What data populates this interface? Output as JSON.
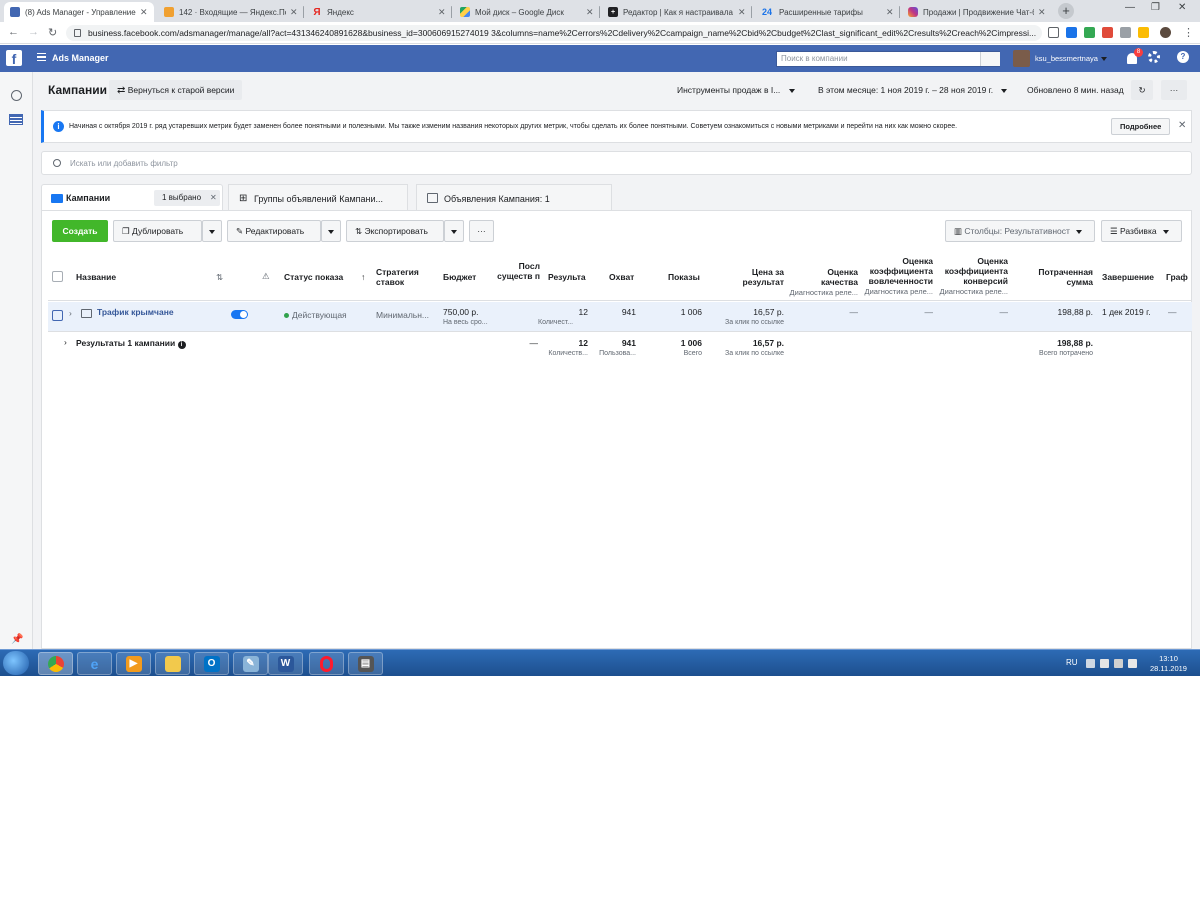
{
  "browser": {
    "tabs": [
      {
        "title": "(8) Ads Manager - Управление р",
        "icon_color": "#4267b2",
        "icon": "document-icon",
        "active": true
      },
      {
        "title": "142 · Входящие — Яндекс.Почта",
        "icon_color": "#f0a030",
        "icon": "mail-icon",
        "active": false
      },
      {
        "title": "Яндекс",
        "icon_color": "#e52620",
        "icon": "yandex-icon",
        "active": false
      },
      {
        "title": "Мой диск – Google Диск",
        "icon_color": "#1fa463",
        "icon": "drive-icon",
        "active": false
      },
      {
        "title": "Редактор | Как я настраивала та",
        "icon_color": "#202124",
        "icon": "plus-icon",
        "active": false
      },
      {
        "title": "Расширенные тарифы",
        "icon_color": "#1a73e8",
        "icon": "24-icon",
        "active": false
      },
      {
        "title": "Продажи | Продвижение Чат-б",
        "icon_color": "#c13584",
        "icon": "instagram-icon",
        "active": false
      }
    ],
    "url": "business.facebook.com/adsmanager/manage/all?act=431346240891628&business_id=300606915274019 3&columns=name%2Cerrors%2Cdelivery%2Ccampaign_name%2Cbid%2Cbudget%2Clast_significant_edit%2Cresults%2Creach%2Cimpressi..."
  },
  "fbbar": {
    "title": "Ads Manager",
    "search_placeholder": "Поиск в компании",
    "username": "ksu_bessmertnaya",
    "notif_count": "8"
  },
  "header": {
    "title": "Кампании",
    "old_version": "Вернуться к старой версии",
    "sales_tools": "Инструменты продаж в I...",
    "date_range": "В этом месяце: 1 ноя 2019 г. – 28 ноя 2019 г.",
    "updated": "Обновлено 8 мин. назад"
  },
  "banner": {
    "text": "Начиная с октября 2019 г. ряд устаревших метрик будет заменен более понятными и полезными. Мы также изменим названия некоторых других метрик, чтобы сделать их более понятными. Советуем ознакомиться с новыми метриками и перейти на них как можно скорее.",
    "more": "Подробнее"
  },
  "filter": {
    "placeholder": "Искать или добавить фильтр"
  },
  "level_tabs": {
    "campaigns": "Кампании",
    "selected": "1 выбрано",
    "adsets": "Группы объявлений Кампани...",
    "ads": "Объявления Кампания: 1"
  },
  "toolbar": {
    "create": "Создать",
    "duplicate": "Дублировать",
    "edit": "Редактировать",
    "export": "Экспортировать",
    "columns": "Столбцы: Результативност",
    "breakdown": "Разбивка"
  },
  "table": {
    "headers": {
      "name": "Название",
      "status": "Статус показа",
      "bid": "Стратегия ставок",
      "budget": "Бюджет",
      "last_edit": "Посл существ п",
      "results": "Результа",
      "reach": "Охват",
      "impressions": "Показы",
      "cpr": "Цена за результат",
      "quality": "Оценка качества",
      "quality_sub": "Диагностика реле...",
      "engagement": "Оценка коэффициента вовлеченности",
      "engagement_sub": "Диагностика реле...",
      "conversion": "Оценка коэффициента конверсий",
      "conversion_sub": "Диагностика реле...",
      "spent": "Потраченная сумма",
      "end": "Завершение",
      "schedule": "Граф"
    },
    "row": {
      "name": "Трафик крымчане",
      "status": "Действующая",
      "bid": "Минимальн...",
      "budget": "750,00 р.",
      "budget_sub": "На весь сро...",
      "results": "12",
      "results_sub": "Количест...",
      "reach": "941",
      "impressions": "1 006",
      "cpr": "16,57 р.",
      "cpr_sub": "За клик по ссылке",
      "quality": "—",
      "engagement": "—",
      "conversion": "—",
      "spent": "198,88 р.",
      "end": "1 дек 2019 г.",
      "schedule": "—"
    },
    "total": {
      "label": "Результаты 1 кампании",
      "last_edit": "—",
      "results": "12",
      "results_sub": "Количеств...",
      "reach": "941",
      "reach_sub": "Пользова...",
      "impressions": "1 006",
      "impressions_sub": "Всего",
      "cpr": "16,57 р.",
      "cpr_sub": "За клик по ссылке",
      "spent": "198,88 р.",
      "spent_sub": "Всего потрачено"
    }
  },
  "taskbar": {
    "lang": "RU",
    "time": "13:10",
    "date": "28.11.2019"
  },
  "colors": {
    "fb_blue": "#4267b2",
    "create_green": "#42b72a",
    "active_dot": "#31a24c",
    "link_blue": "#1877f2"
  }
}
